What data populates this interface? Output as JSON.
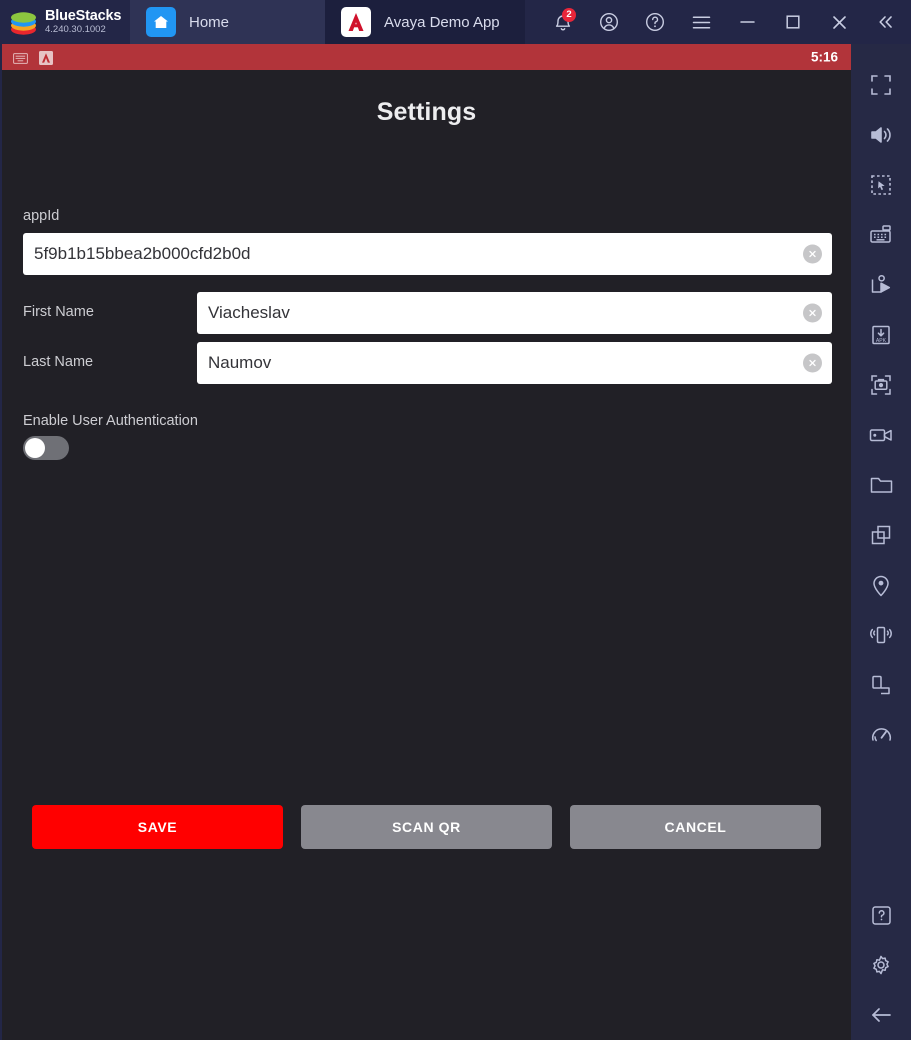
{
  "titlebar": {
    "brand_name": "BlueStacks",
    "brand_version": "4.240.30.1002",
    "tabs": [
      {
        "label": "Home",
        "icon": "home-icon",
        "active": true
      },
      {
        "label": "Avaya Demo App",
        "icon": "avaya-logo-icon",
        "active": false
      }
    ],
    "actions": [
      {
        "name": "notifications-button",
        "icon": "bell-icon",
        "badge": "2"
      },
      {
        "name": "account-button",
        "icon": "user-circle-icon"
      },
      {
        "name": "help-button",
        "icon": "question-circle-icon"
      },
      {
        "name": "menu-button",
        "icon": "hamburger-menu-icon"
      },
      {
        "name": "minimize-button",
        "icon": "minimize-icon"
      },
      {
        "name": "maximize-button",
        "icon": "maximize-square-icon"
      },
      {
        "name": "close-button",
        "icon": "close-x-icon"
      },
      {
        "name": "collapse-sidebar-button",
        "icon": "double-chevron-left-icon"
      }
    ]
  },
  "android_status_bar": {
    "clock": "5:16",
    "icons": [
      "keyboard-status-icon",
      "avaya-app-status-icon"
    ],
    "background_color": "#b2343a"
  },
  "app": {
    "page_title": "Settings",
    "fields": {
      "appid": {
        "label": "appId",
        "value": "5f9b1b15bbea2b000cfd2b0d",
        "placeholder": "appId"
      },
      "first_name": {
        "label": "First Name",
        "value": "Viacheslav",
        "placeholder": "First Name"
      },
      "last_name": {
        "label": "Last Name",
        "value": "Naumov",
        "placeholder": "Last Name"
      }
    },
    "auth_toggle": {
      "label": "Enable User Authentication",
      "state": "off"
    },
    "buttons": [
      {
        "label": "SAVE",
        "style": "save",
        "color": "#ff0000"
      },
      {
        "label": "SCAN QR",
        "style": "grey",
        "color": "#88888f"
      },
      {
        "label": "CANCEL",
        "style": "grey",
        "color": "#88888f"
      }
    ]
  },
  "sidebar": {
    "top_items": [
      {
        "name": "fullscreen-button",
        "icon": "fullscreen-icon"
      },
      {
        "name": "volume-button",
        "icon": "volume-icon"
      },
      {
        "name": "multi-select-button",
        "icon": "marquee-cursor-icon"
      },
      {
        "name": "keyboard-controls-button",
        "icon": "keyboard-icon"
      },
      {
        "name": "game-controls-button",
        "icon": "gamepad-play-icon"
      },
      {
        "name": "install-apk-button",
        "icon": "apk-download-icon"
      },
      {
        "name": "screenshot-button",
        "icon": "camera-frame-icon"
      },
      {
        "name": "record-screen-button",
        "icon": "video-camera-icon"
      },
      {
        "name": "media-manager-button",
        "icon": "folder-icon"
      },
      {
        "name": "multi-instance-button",
        "icon": "copy-windows-icon"
      },
      {
        "name": "location-button",
        "icon": "map-pin-icon"
      },
      {
        "name": "shake-button",
        "icon": "shake-phone-icon"
      },
      {
        "name": "rotate-button",
        "icon": "rotate-screen-icon"
      },
      {
        "name": "performance-button",
        "icon": "speedometer-icon"
      }
    ],
    "bottom_items": [
      {
        "name": "help-button",
        "icon": "question-box-icon"
      },
      {
        "name": "settings-button",
        "icon": "gear-icon"
      },
      {
        "name": "back-button",
        "icon": "arrow-left-icon"
      }
    ]
  },
  "theme": {
    "titlebar_bg": "#232647",
    "sidebar_bg": "#262945",
    "app_bg": "#212026",
    "accent_red": "#ff0000",
    "status_bar_red": "#b2343a"
  }
}
